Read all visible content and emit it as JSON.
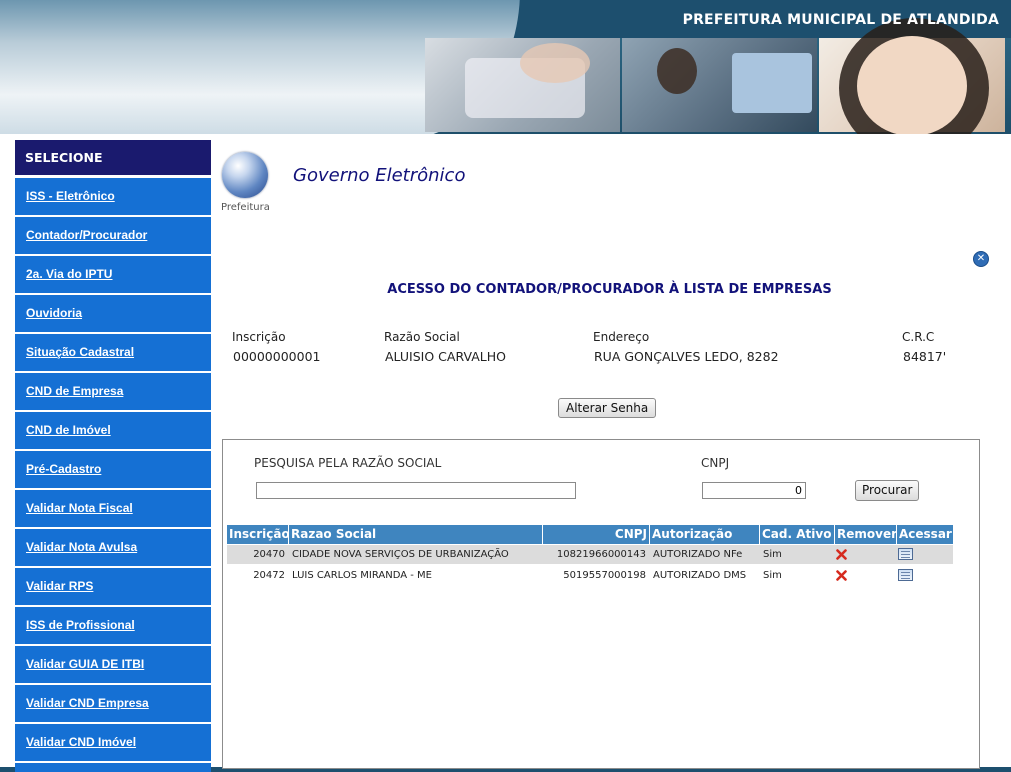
{
  "header": {
    "title": "PREFEITURA MUNICIPAL DE ATLANDIDA"
  },
  "sidebar": {
    "title": "SELECIONE",
    "items": [
      {
        "label": "ISS - Eletrônico"
      },
      {
        "label": "Contador/Procurador"
      },
      {
        "label": "2a. Via do IPTU"
      },
      {
        "label": "Ouvidoria"
      },
      {
        "label": "Situação Cadastral"
      },
      {
        "label": "CND de Empresa"
      },
      {
        "label": "CND de Imóvel"
      },
      {
        "label": "Pré-Cadastro"
      },
      {
        "label": "Validar Nota Fiscal"
      },
      {
        "label": "Validar Nota Avulsa"
      },
      {
        "label": "Validar RPS"
      },
      {
        "label": "ISS de Profissional"
      },
      {
        "label": "Validar GUIA DE ITBI"
      },
      {
        "label": "Validar CND Empresa"
      },
      {
        "label": "Validar CND Imóvel"
      }
    ]
  },
  "main": {
    "logo_label": "Prefeitura",
    "section_title": "Governo Eletrônico",
    "page_heading": "ACESSO DO CONTADOR/PROCURADOR À LISTA DE EMPRESAS",
    "info": {
      "labels": [
        "Inscrição",
        "Razão Social",
        "Endereço",
        "C.R.C"
      ],
      "values": [
        "00000000001",
        "ALUISIO CARVALHO",
        "RUA GONÇALVES LEDO, 8282",
        "84817'"
      ]
    },
    "change_password_label": "Alterar Senha"
  },
  "search": {
    "razao_label": "PESQUISA PELA RAZÃO SOCIAL",
    "razao_value": "",
    "cnpj_label": "CNPJ",
    "cnpj_value": "0",
    "button_label": "Procurar"
  },
  "table": {
    "headers": [
      "Inscrição",
      "Razao Social",
      "CNPJ",
      "Autorização",
      "Cad. Ativo",
      "Remover",
      "Acessar"
    ],
    "rows": [
      {
        "inscricao": "20470",
        "razao": "CIDADE NOVA SERVIÇOS DE URBANIZAÇÃO",
        "cnpj": "10821966000143",
        "autorizacao": "AUTORIZADO NFe",
        "ativo": "Sim"
      },
      {
        "inscricao": "20472",
        "razao": "LUIS CARLOS MIRANDA - ME",
        "cnpj": "5019557000198",
        "autorizacao": "AUTORIZADO DMS",
        "ativo": "Sim"
      }
    ]
  },
  "icons": {
    "close": "close-icon",
    "remove": "delete-x-icon",
    "access": "open-window-icon",
    "logo": "globe-icon"
  },
  "colors": {
    "sidebar_item": "#1570d4",
    "sidebar_title": "#1a1a6e",
    "table_header": "#3f85bf",
    "heading_text": "#12127a",
    "row_alt": "#dcdcdc"
  }
}
